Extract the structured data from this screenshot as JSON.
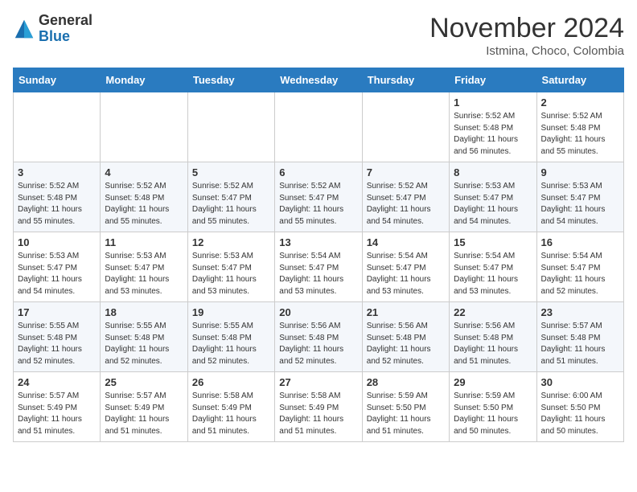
{
  "header": {
    "logo_general": "General",
    "logo_blue": "Blue",
    "month_title": "November 2024",
    "location": "Istmina, Choco, Colombia"
  },
  "weekdays": [
    "Sunday",
    "Monday",
    "Tuesday",
    "Wednesday",
    "Thursday",
    "Friday",
    "Saturday"
  ],
  "weeks": [
    [
      {
        "day": "",
        "info": ""
      },
      {
        "day": "",
        "info": ""
      },
      {
        "day": "",
        "info": ""
      },
      {
        "day": "",
        "info": ""
      },
      {
        "day": "",
        "info": ""
      },
      {
        "day": "1",
        "info": "Sunrise: 5:52 AM\nSunset: 5:48 PM\nDaylight: 11 hours\nand 56 minutes."
      },
      {
        "day": "2",
        "info": "Sunrise: 5:52 AM\nSunset: 5:48 PM\nDaylight: 11 hours\nand 55 minutes."
      }
    ],
    [
      {
        "day": "3",
        "info": "Sunrise: 5:52 AM\nSunset: 5:48 PM\nDaylight: 11 hours\nand 55 minutes."
      },
      {
        "day": "4",
        "info": "Sunrise: 5:52 AM\nSunset: 5:48 PM\nDaylight: 11 hours\nand 55 minutes."
      },
      {
        "day": "5",
        "info": "Sunrise: 5:52 AM\nSunset: 5:47 PM\nDaylight: 11 hours\nand 55 minutes."
      },
      {
        "day": "6",
        "info": "Sunrise: 5:52 AM\nSunset: 5:47 PM\nDaylight: 11 hours\nand 55 minutes."
      },
      {
        "day": "7",
        "info": "Sunrise: 5:52 AM\nSunset: 5:47 PM\nDaylight: 11 hours\nand 54 minutes."
      },
      {
        "day": "8",
        "info": "Sunrise: 5:53 AM\nSunset: 5:47 PM\nDaylight: 11 hours\nand 54 minutes."
      },
      {
        "day": "9",
        "info": "Sunrise: 5:53 AM\nSunset: 5:47 PM\nDaylight: 11 hours\nand 54 minutes."
      }
    ],
    [
      {
        "day": "10",
        "info": "Sunrise: 5:53 AM\nSunset: 5:47 PM\nDaylight: 11 hours\nand 54 minutes."
      },
      {
        "day": "11",
        "info": "Sunrise: 5:53 AM\nSunset: 5:47 PM\nDaylight: 11 hours\nand 53 minutes."
      },
      {
        "day": "12",
        "info": "Sunrise: 5:53 AM\nSunset: 5:47 PM\nDaylight: 11 hours\nand 53 minutes."
      },
      {
        "day": "13",
        "info": "Sunrise: 5:54 AM\nSunset: 5:47 PM\nDaylight: 11 hours\nand 53 minutes."
      },
      {
        "day": "14",
        "info": "Sunrise: 5:54 AM\nSunset: 5:47 PM\nDaylight: 11 hours\nand 53 minutes."
      },
      {
        "day": "15",
        "info": "Sunrise: 5:54 AM\nSunset: 5:47 PM\nDaylight: 11 hours\nand 53 minutes."
      },
      {
        "day": "16",
        "info": "Sunrise: 5:54 AM\nSunset: 5:47 PM\nDaylight: 11 hours\nand 52 minutes."
      }
    ],
    [
      {
        "day": "17",
        "info": "Sunrise: 5:55 AM\nSunset: 5:48 PM\nDaylight: 11 hours\nand 52 minutes."
      },
      {
        "day": "18",
        "info": "Sunrise: 5:55 AM\nSunset: 5:48 PM\nDaylight: 11 hours\nand 52 minutes."
      },
      {
        "day": "19",
        "info": "Sunrise: 5:55 AM\nSunset: 5:48 PM\nDaylight: 11 hours\nand 52 minutes."
      },
      {
        "day": "20",
        "info": "Sunrise: 5:56 AM\nSunset: 5:48 PM\nDaylight: 11 hours\nand 52 minutes."
      },
      {
        "day": "21",
        "info": "Sunrise: 5:56 AM\nSunset: 5:48 PM\nDaylight: 11 hours\nand 52 minutes."
      },
      {
        "day": "22",
        "info": "Sunrise: 5:56 AM\nSunset: 5:48 PM\nDaylight: 11 hours\nand 51 minutes."
      },
      {
        "day": "23",
        "info": "Sunrise: 5:57 AM\nSunset: 5:48 PM\nDaylight: 11 hours\nand 51 minutes."
      }
    ],
    [
      {
        "day": "24",
        "info": "Sunrise: 5:57 AM\nSunset: 5:49 PM\nDaylight: 11 hours\nand 51 minutes."
      },
      {
        "day": "25",
        "info": "Sunrise: 5:57 AM\nSunset: 5:49 PM\nDaylight: 11 hours\nand 51 minutes."
      },
      {
        "day": "26",
        "info": "Sunrise: 5:58 AM\nSunset: 5:49 PM\nDaylight: 11 hours\nand 51 minutes."
      },
      {
        "day": "27",
        "info": "Sunrise: 5:58 AM\nSunset: 5:49 PM\nDaylight: 11 hours\nand 51 minutes."
      },
      {
        "day": "28",
        "info": "Sunrise: 5:59 AM\nSunset: 5:50 PM\nDaylight: 11 hours\nand 51 minutes."
      },
      {
        "day": "29",
        "info": "Sunrise: 5:59 AM\nSunset: 5:50 PM\nDaylight: 11 hours\nand 50 minutes."
      },
      {
        "day": "30",
        "info": "Sunrise: 6:00 AM\nSunset: 5:50 PM\nDaylight: 11 hours\nand 50 minutes."
      }
    ]
  ]
}
